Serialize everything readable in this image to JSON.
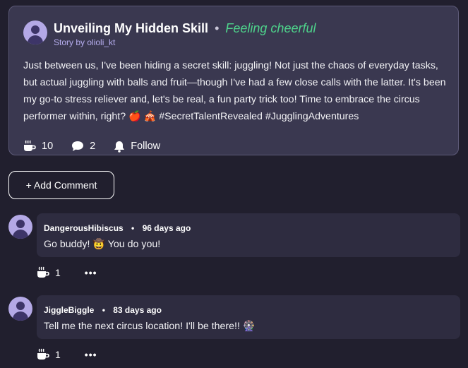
{
  "post": {
    "title": "Unveiling My Hidden Skill",
    "separator": "•",
    "feeling": "Feeling cheerful",
    "byline": "Story by olioli_kt",
    "body": "Just between us, I've been hiding a secret skill: juggling! Not just the chaos of everyday tasks, but actual juggling with balls and fruit—though I've had a few close calls with the latter. It's been my go-to stress reliever and, let's be real, a fun party trick too! Time to embrace the circus performer within, right? 🍎 🎪 #SecretTalentRevealed #JugglingAdventures",
    "actions": {
      "coffee_count": "10",
      "comment_count": "2",
      "follow_label": "Follow"
    }
  },
  "add_comment_label": "+ Add Comment",
  "comments": [
    {
      "author": "DangerousHibiscus",
      "separator": "•",
      "time": "96 days ago",
      "text": "Go buddy! 🤠 You do you!",
      "coffee_count": "1",
      "more": "•••"
    },
    {
      "author": "JiggleBiggle",
      "separator": "•",
      "time": "83 days ago",
      "text": "Tell me the next circus location! I'll be there!! 🎡",
      "coffee_count": "1",
      "more": "•••"
    }
  ],
  "icons": {
    "coffee": "coffee-cup-icon",
    "comment": "speech-bubble-icon",
    "follow": "bell-icon",
    "avatar": "user-avatar-icon"
  },
  "colors": {
    "background": "#211f2e",
    "card": "#3a3850",
    "comment_bubble": "#2e2c40",
    "feeling": "#4ed38b",
    "byline": "#b7aef0",
    "avatar": "#b4a9e6"
  }
}
